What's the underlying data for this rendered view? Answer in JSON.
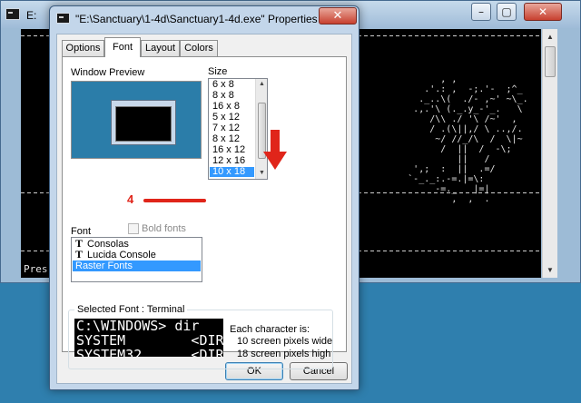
{
  "console": {
    "title": "E:",
    "min_glyph": "–",
    "restore_glyph": "▢",
    "close_glyph": "✕",
    "art": "              , ,                 \n           .'.: ,  -;.'-  ;^_     \n          ._..\\(  ./- ,~' ~\\_.     \n         .,.'\\ (._.y_-'_.   \\     \n            /\\\\ ./ '\\ /~'  ,     \n            / .(\\||,/ \\ ..,/.     \n             ~/ //_/\\  /  \\|~     \n              /  ||  /  -\\;       \n                 ||   /           \n         ',;  :  ||  .=/          \n        `-_._:.-=.|=\\:            \n             -=._   |=|           \n                ,  ,  .           ",
    "press_text": "Pres"
  },
  "dialog": {
    "title": "\"E:\\Sanctuary\\1-4d\\Sanctuary1-4d.exe\" Properties",
    "close_glyph": "✕",
    "tabs": [
      {
        "label": "Options"
      },
      {
        "label": "Font"
      },
      {
        "label": "Layout"
      },
      {
        "label": "Colors"
      }
    ],
    "active_tab": "Font",
    "window_preview_label": "Window Preview",
    "size_label": "Size",
    "sizes": [
      "6 x  8",
      "8 x  8",
      "16 x  8",
      "5 x 12",
      "7 x 12",
      "8 x 12",
      "16 x 12",
      "12 x 16",
      "10 x 18"
    ],
    "selected_size": "10 x 18",
    "annotation_number": "4",
    "font_label": "Font",
    "bold_fonts_label": "Bold fonts",
    "bold_fonts_checked": false,
    "fonts": [
      {
        "name": "Consolas",
        "truetype": true
      },
      {
        "name": "Lucida Console",
        "truetype": true
      },
      {
        "name": "Raster Fonts",
        "truetype": false
      }
    ],
    "selected_font": "Raster Fonts",
    "selected_font_label": "Selected Font : Terminal",
    "sample_lines": [
      "C:\\WINDOWS> dir",
      "SYSTEM        <DIR",
      "SYSTEM32      <DIR"
    ],
    "char_info": {
      "heading": "Each character is:",
      "width_line": "10 screen pixels wide",
      "height_line": "18 screen pixels high"
    },
    "ok_label": "OK",
    "cancel_label": "Cancel"
  },
  "colors": {
    "desktop": "#2f7fae",
    "selection": "#3399ff",
    "annotation": "#e0251a"
  },
  "icons": {
    "console_app": "console-app-icon",
    "truetype": "truetype-font-icon",
    "arrow": "annotation-arrow-down"
  }
}
